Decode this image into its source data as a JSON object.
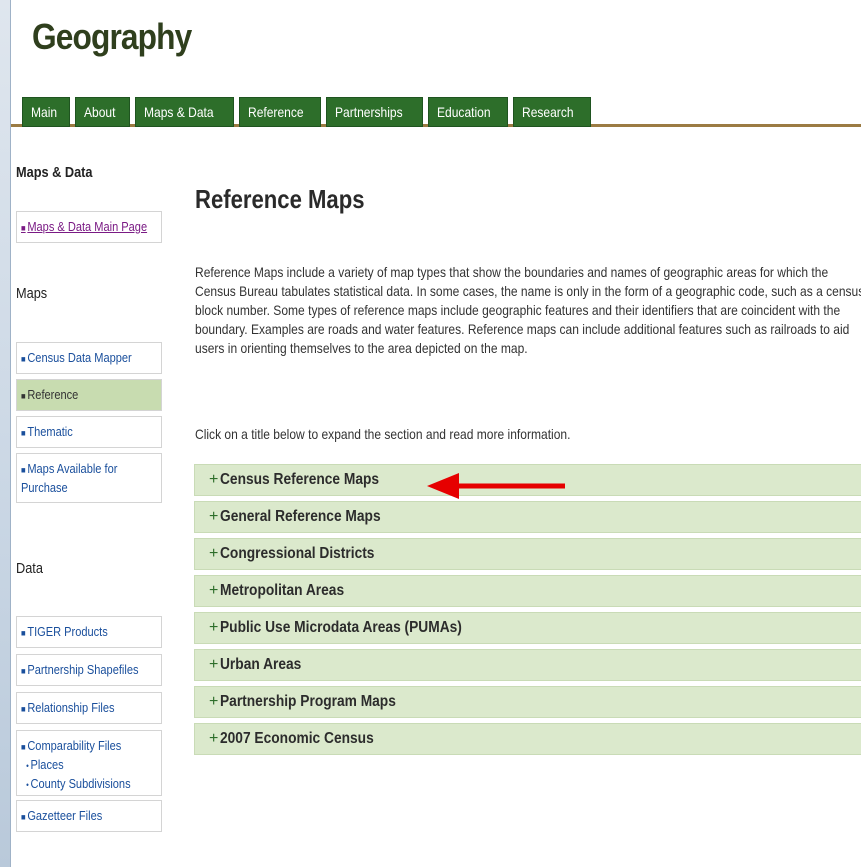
{
  "site_title": "Geography",
  "nav": {
    "tabs": [
      "Main",
      "About",
      "Maps & Data",
      "Reference",
      "Partnerships",
      "Education",
      "Research"
    ]
  },
  "sidebar": {
    "section_heading": "Maps & Data",
    "main_page_link": "Maps & Data Main Page",
    "maps_heading": "Maps",
    "maps_items": [
      "Census Data Mapper",
      "Reference",
      "Thematic",
      "Maps Available for Purchase"
    ],
    "data_heading": "Data",
    "data_items": {
      "tiger": "TIGER Products",
      "partnership": "Partnership Shapefiles",
      "relationship": "Relationship Files",
      "comparability": "Comparability Files",
      "comparability_sub1": "Places",
      "comparability_sub2": "County Subdivisions",
      "gazetteer": "Gazetteer Files"
    }
  },
  "main": {
    "title": "Reference Maps",
    "intro": "Reference Maps include a variety of map types that show the boundaries and names of geographic areas for which the Census Bureau tabulates statistical data. In some cases, the name is only in the form of a geographic code, such as a census block number. Some types of reference maps include geographic features and their identifiers that are coincident with the boundary. Examples are roads and water features. Reference maps can include additional features such as railroads to aid users in orienting themselves to the area depicted on the map.",
    "instruction": "Click on a title below to expand the section and read more information.",
    "sections": [
      "Census Reference Maps",
      "General Reference Maps",
      "Congressional Districts",
      "Metropolitan Areas",
      "Public Use Microdata Areas (PUMAs)",
      "Urban Areas",
      "Partnership Program Maps",
      "2007 Economic Census"
    ]
  },
  "colors": {
    "nav_tab": "#2d6e2a",
    "section_bg": "#dbe9cc",
    "sidebar_active": "#c8dcb0",
    "link": "#1a4f9c",
    "annotation_arrow": "#e60000"
  }
}
